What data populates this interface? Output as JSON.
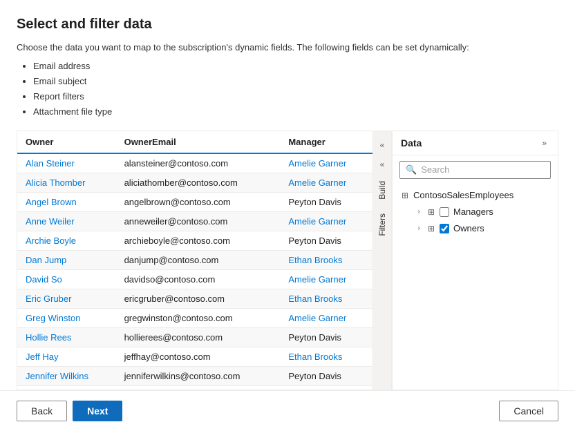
{
  "page": {
    "title": "Select and filter data",
    "description": "Choose the data you want to map to the subscription's dynamic fields. The following fields can be set dynamically:",
    "bullets": [
      "Email address",
      "Email subject",
      "Report filters",
      "Attachment file type"
    ]
  },
  "table": {
    "columns": [
      "Owner",
      "OwnerEmail",
      "Manager"
    ],
    "rows": [
      {
        "owner": "Alan Steiner",
        "email": "alansteiner@contoso.com",
        "manager": "Amelie Garner",
        "manager_highlight": true
      },
      {
        "owner": "Alicia Thomber",
        "email": "aliciathomber@contoso.com",
        "manager": "Amelie Garner",
        "manager_highlight": true
      },
      {
        "owner": "Angel Brown",
        "email": "angelbrown@contoso.com",
        "manager": "Peyton Davis",
        "manager_highlight": false
      },
      {
        "owner": "Anne Weiler",
        "email": "anneweiler@contoso.com",
        "manager": "Amelie Garner",
        "manager_highlight": true
      },
      {
        "owner": "Archie Boyle",
        "email": "archieboyle@contoso.com",
        "manager": "Peyton Davis",
        "manager_highlight": false
      },
      {
        "owner": "Dan Jump",
        "email": "danjump@contoso.com",
        "manager": "Ethan Brooks",
        "manager_highlight": true
      },
      {
        "owner": "David So",
        "email": "davidso@contoso.com",
        "manager": "Amelie Garner",
        "manager_highlight": true
      },
      {
        "owner": "Eric Gruber",
        "email": "ericgruber@contoso.com",
        "manager": "Ethan Brooks",
        "manager_highlight": true
      },
      {
        "owner": "Greg Winston",
        "email": "gregwinston@contoso.com",
        "manager": "Amelie Garner",
        "manager_highlight": true
      },
      {
        "owner": "Hollie Rees",
        "email": "hollierees@contoso.com",
        "manager": "Peyton Davis",
        "manager_highlight": false
      },
      {
        "owner": "Jeff Hay",
        "email": "jeffhay@contoso.com",
        "manager": "Ethan Brooks",
        "manager_highlight": true
      },
      {
        "owner": "Jennifer Wilkins",
        "email": "jenniferwilkins@contoso.com",
        "manager": "Peyton Davis",
        "manager_highlight": false
      }
    ]
  },
  "tabs": {
    "build_label": "Build",
    "filters_label": "Filters"
  },
  "nav_buttons": {
    "collapse_left": "«",
    "collapse_right": "»"
  },
  "data_panel": {
    "title": "Data",
    "expand_btn": "»",
    "search_placeholder": "Search",
    "dataset": "ContosoSalesEmployees",
    "tree_items": [
      {
        "label": "Managers",
        "checked": false
      },
      {
        "label": "Owners",
        "checked": true
      }
    ]
  },
  "footer": {
    "back_label": "Back",
    "next_label": "Next",
    "cancel_label": "Cancel"
  }
}
